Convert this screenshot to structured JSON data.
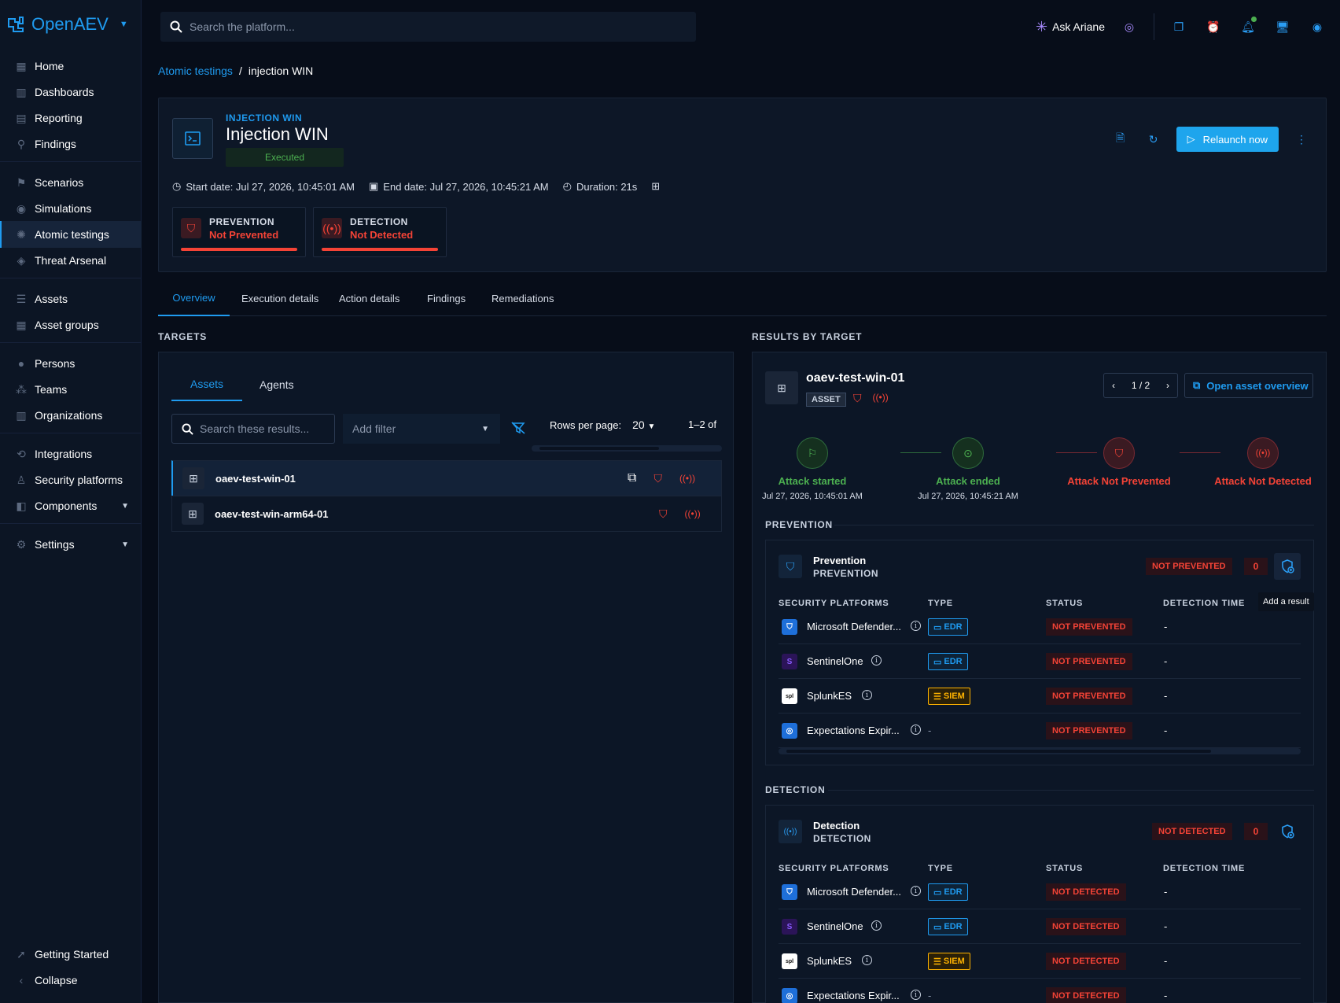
{
  "app": {
    "name": "OpenAEV"
  },
  "sidebar": {
    "items": [
      {
        "label": "Home",
        "icon": "home-icon"
      },
      {
        "label": "Dashboards",
        "icon": "dashboard-icon"
      },
      {
        "label": "Reporting",
        "icon": "reporting-icon"
      },
      {
        "label": "Findings",
        "icon": "findings-icon"
      },
      {
        "label": "Scenarios",
        "icon": "scenarios-icon"
      },
      {
        "label": "Simulations",
        "icon": "simulations-icon"
      },
      {
        "label": "Atomic testings",
        "icon": "atomic-testing-icon"
      },
      {
        "label": "Threat Arsenal",
        "icon": "threat-arsenal-icon"
      },
      {
        "label": "Assets",
        "icon": "assets-icon"
      },
      {
        "label": "Asset groups",
        "icon": "asset-groups-icon"
      },
      {
        "label": "Persons",
        "icon": "persons-icon"
      },
      {
        "label": "Teams",
        "icon": "teams-icon"
      },
      {
        "label": "Organizations",
        "icon": "organizations-icon"
      },
      {
        "label": "Integrations",
        "icon": "integrations-icon"
      },
      {
        "label": "Security platforms",
        "icon": "security-platforms-icon"
      },
      {
        "label": "Components",
        "icon": "components-icon"
      },
      {
        "label": "Settings",
        "icon": "settings-icon"
      }
    ],
    "getting_started": "Getting Started",
    "collapse": "Collapse"
  },
  "topbar": {
    "search_placeholder": "Search the platform...",
    "ask_label": "Ask Ariane"
  },
  "breadcrumb": {
    "parent": "Atomic testings",
    "separator": "/",
    "current": "injection WIN"
  },
  "header": {
    "supertitle": "INJECTION WIN",
    "title": "Injection WIN",
    "status": "Executed",
    "start_date": "Start date: Jul 27, 2026, 10:45:01 AM",
    "end_date": "End date: Jul 27, 2026, 10:45:21 AM",
    "duration": "Duration: 21s",
    "relaunch_label": "Relaunch now",
    "scores": [
      {
        "label": "PREVENTION",
        "value": "Not Prevented"
      },
      {
        "label": "DETECTION",
        "value": "Not Detected"
      }
    ]
  },
  "tabs": [
    "Overview",
    "Execution details",
    "Action details",
    "Findings",
    "Remediations"
  ],
  "targets": {
    "section_title": "TARGETS",
    "tabs": [
      "Assets",
      "Agents"
    ],
    "search_placeholder": "Search these results...",
    "filter_placeholder": "Add filter",
    "rows_per_page_label": "Rows per page:",
    "rows_per_page_value": "20",
    "pagination": "1–2 of",
    "rows": [
      {
        "name": "oaev-test-win-01"
      },
      {
        "name": "oaev-test-win-arm64-01"
      }
    ]
  },
  "results": {
    "section_title": "RESULTS BY TARGET",
    "asset_name": "oaev-test-win-01",
    "asset_badge": "ASSET",
    "pager": "1 / 2",
    "open_label": "Open asset overview",
    "steps": [
      {
        "title": "Attack started",
        "date": "Jul 27, 2026, 10:45:01 AM"
      },
      {
        "title": "Attack ended",
        "date": "Jul 27, 2026, 10:45:21 AM"
      },
      {
        "title": "Attack Not Prevented",
        "date": ""
      },
      {
        "title": "Attack Not Detected",
        "date": ""
      }
    ],
    "prevention": {
      "section": "PREVENTION",
      "title": "Prevention",
      "subtitle": "PREVENTION",
      "status": "NOT PREVENTED",
      "count": "0",
      "tooltip": "Add a result",
      "rows": [
        {
          "name": "Microsoft Defender...",
          "type": "EDR",
          "status": "NOT PREVENTED",
          "time": "-"
        },
        {
          "name": "SentinelOne",
          "type": "EDR",
          "status": "NOT PREVENTED",
          "time": "-"
        },
        {
          "name": "SplunkES",
          "type": "SIEM",
          "status": "NOT PREVENTED",
          "time": "-"
        },
        {
          "name": "Expectations Expir...",
          "type": "-",
          "status": "NOT PREVENTED",
          "time": "-"
        }
      ]
    },
    "detection": {
      "section": "DETECTION",
      "title": "Detection",
      "subtitle": "DETECTION",
      "status": "NOT DETECTED",
      "count": "0",
      "rows": [
        {
          "name": "Microsoft Defender...",
          "type": "EDR",
          "status": "NOT DETECTED",
          "time": "-"
        },
        {
          "name": "SentinelOne",
          "type": "EDR",
          "status": "NOT DETECTED",
          "time": "-"
        },
        {
          "name": "SplunkES",
          "type": "SIEM",
          "status": "NOT DETECTED",
          "time": "-"
        },
        {
          "name": "Expectations Expir...",
          "type": "-",
          "status": "NOT DETECTED",
          "time": "-"
        }
      ]
    },
    "columns": [
      "SECURITY PLATFORMS",
      "TYPE",
      "STATUS",
      "DETECTION TIME"
    ]
  },
  "colors": {
    "accent": "#1f9bf0",
    "danger": "#f44336",
    "success": "#4caf50",
    "siem": "#ffb300"
  }
}
